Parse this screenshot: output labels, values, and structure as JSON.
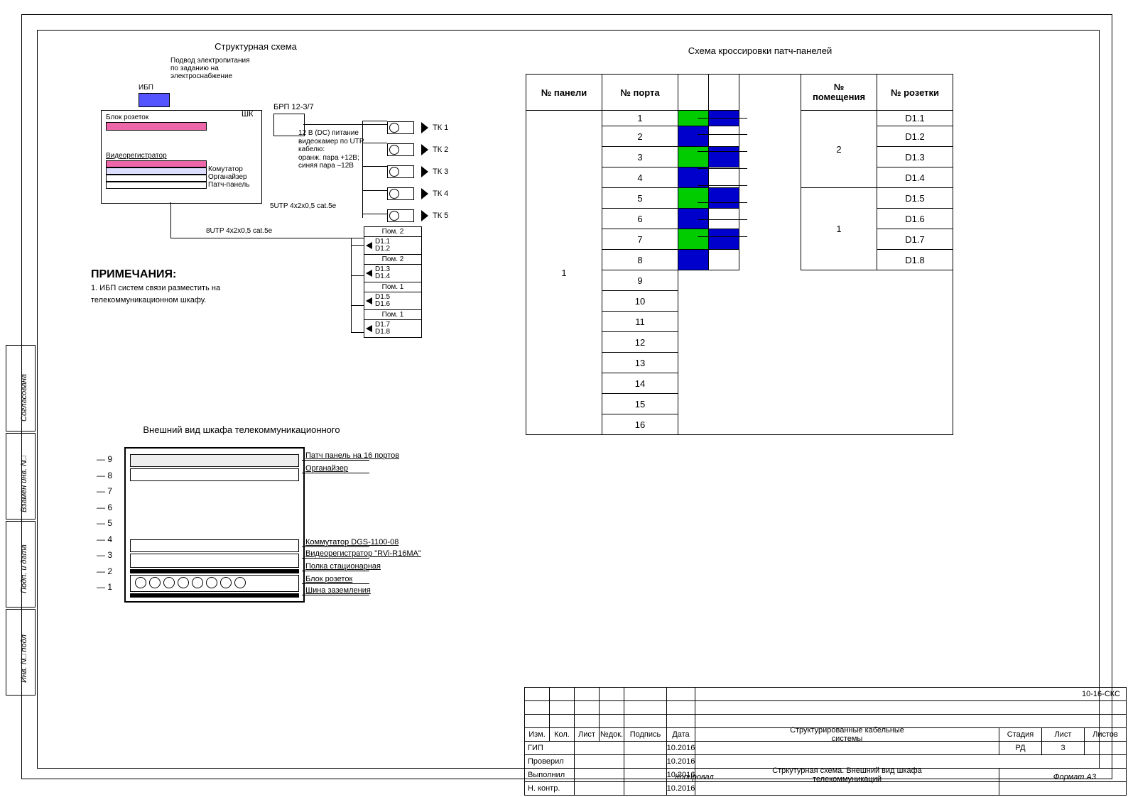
{
  "titles": {
    "struct": "Структурная схема",
    "cross": "Схема кроссировки патч-панелей",
    "rack": "Внешний вид шкафа телекоммуникационного"
  },
  "power": {
    "supply": "Подвод электропитания\nпо заданию на\nэлектроснабжение",
    "ups": "ИБП",
    "outlet_block": "Блок розеток",
    "cabinet_label": "ШК",
    "brp": "БРП 12-3/7",
    "brp_note": "12 В (DC) питание\nвидеокамер по UTP\nкабелю:\nоранж. пара +12В;\nсиняя пара –12В"
  },
  "rack_items": {
    "dvr": "Видеорегистратор",
    "switch": "Комутатор",
    "organizer": "Органайзер",
    "patch": "Патч-панель"
  },
  "cameras": [
    "ТК 1",
    "ТК 2",
    "ТК 3",
    "ТК 4",
    "ТК 5"
  ],
  "cable_labels": {
    "utp5": "5UTP 4x2x0,5 cat.5e",
    "utp8": "8UTP 4x2x0,5 cat.5e"
  },
  "rooms": [
    {
      "hdr": "Пом. 2",
      "ports": "D1.1\nD1.2"
    },
    {
      "hdr": "Пом. 2",
      "ports": "D1.3\nD1.4"
    },
    {
      "hdr": "Пом. 1",
      "ports": "D1.5\nD1.6"
    },
    {
      "hdr": "Пом. 1",
      "ports": "D1.7\nD1.8"
    }
  ],
  "notes": {
    "heading": "ПРИМЕЧАНИЯ:",
    "line1": "1. ИБП систем связи разместить на\n   телекоммуникационном шкафу."
  },
  "cross_table": {
    "headers": [
      "№ панели",
      "№ порта",
      "",
      "",
      "№\nпомещения",
      "№ розетки"
    ],
    "panel": "1",
    "rows": [
      {
        "port": "1",
        "color1": "green",
        "color2": "blue",
        "room": "2",
        "socket": "D1.1"
      },
      {
        "port": "2",
        "color1": "blue",
        "color2": "",
        "room": "",
        "socket": "D1.2"
      },
      {
        "port": "3",
        "color1": "green",
        "color2": "blue",
        "room": "",
        "socket": "D1.3"
      },
      {
        "port": "4",
        "color1": "blue",
        "color2": "",
        "room": "",
        "socket": "D1.4"
      },
      {
        "port": "5",
        "color1": "green",
        "color2": "blue",
        "room": "1",
        "socket": "D1.5"
      },
      {
        "port": "6",
        "color1": "blue",
        "color2": "",
        "room": "",
        "socket": "D1.6"
      },
      {
        "port": "7",
        "color1": "green",
        "color2": "blue",
        "room": "",
        "socket": "D1.7"
      },
      {
        "port": "8",
        "color1": "blue",
        "color2": "",
        "room": "",
        "socket": "D1.8"
      }
    ],
    "empty_ports": [
      "9",
      "10",
      "11",
      "12",
      "13",
      "14",
      "15",
      "16"
    ],
    "rooms": [
      "2",
      "1"
    ]
  },
  "rack_view": {
    "units": [
      "9",
      "8",
      "7",
      "6",
      "5",
      "4",
      "3",
      "2",
      "1"
    ],
    "labels": {
      "patch16": "Патч панель на 16 портов",
      "organizer": "Органайзер",
      "switch": "Коммутатор DGS-1100-08",
      "dvr": "Видеорегистратор \"RVi-R16MA\"",
      "shelf": "Полка стационарная",
      "sockets": "Блок розеток",
      "ground": "Шина заземления"
    }
  },
  "title_block": {
    "code": "10-16-СКС",
    "cols": [
      "Изм.",
      "Кол.",
      "Лист",
      "№док.",
      "Подпись",
      "Дата"
    ],
    "roles": [
      "ГИП",
      "Проверил",
      "Выполнил",
      "Н. контр."
    ],
    "date": "10.2016",
    "project": "Структурированные кабельные\nсистемы",
    "sheet_name": "Стркутурная схема. Внешний вид шкафа\nтелекоммуникаций",
    "stage_h": "Стадия",
    "stage": "РД",
    "sheet_h": "Лист",
    "sheet": "3",
    "total_h": "Листов",
    "total": ""
  },
  "footer": {
    "copy": "Копировал",
    "format": "Формат А3"
  },
  "left_tabs": [
    "Согласована",
    "Взамен инв. N□",
    "Подп. и дата",
    "Инв. N□ подл"
  ]
}
